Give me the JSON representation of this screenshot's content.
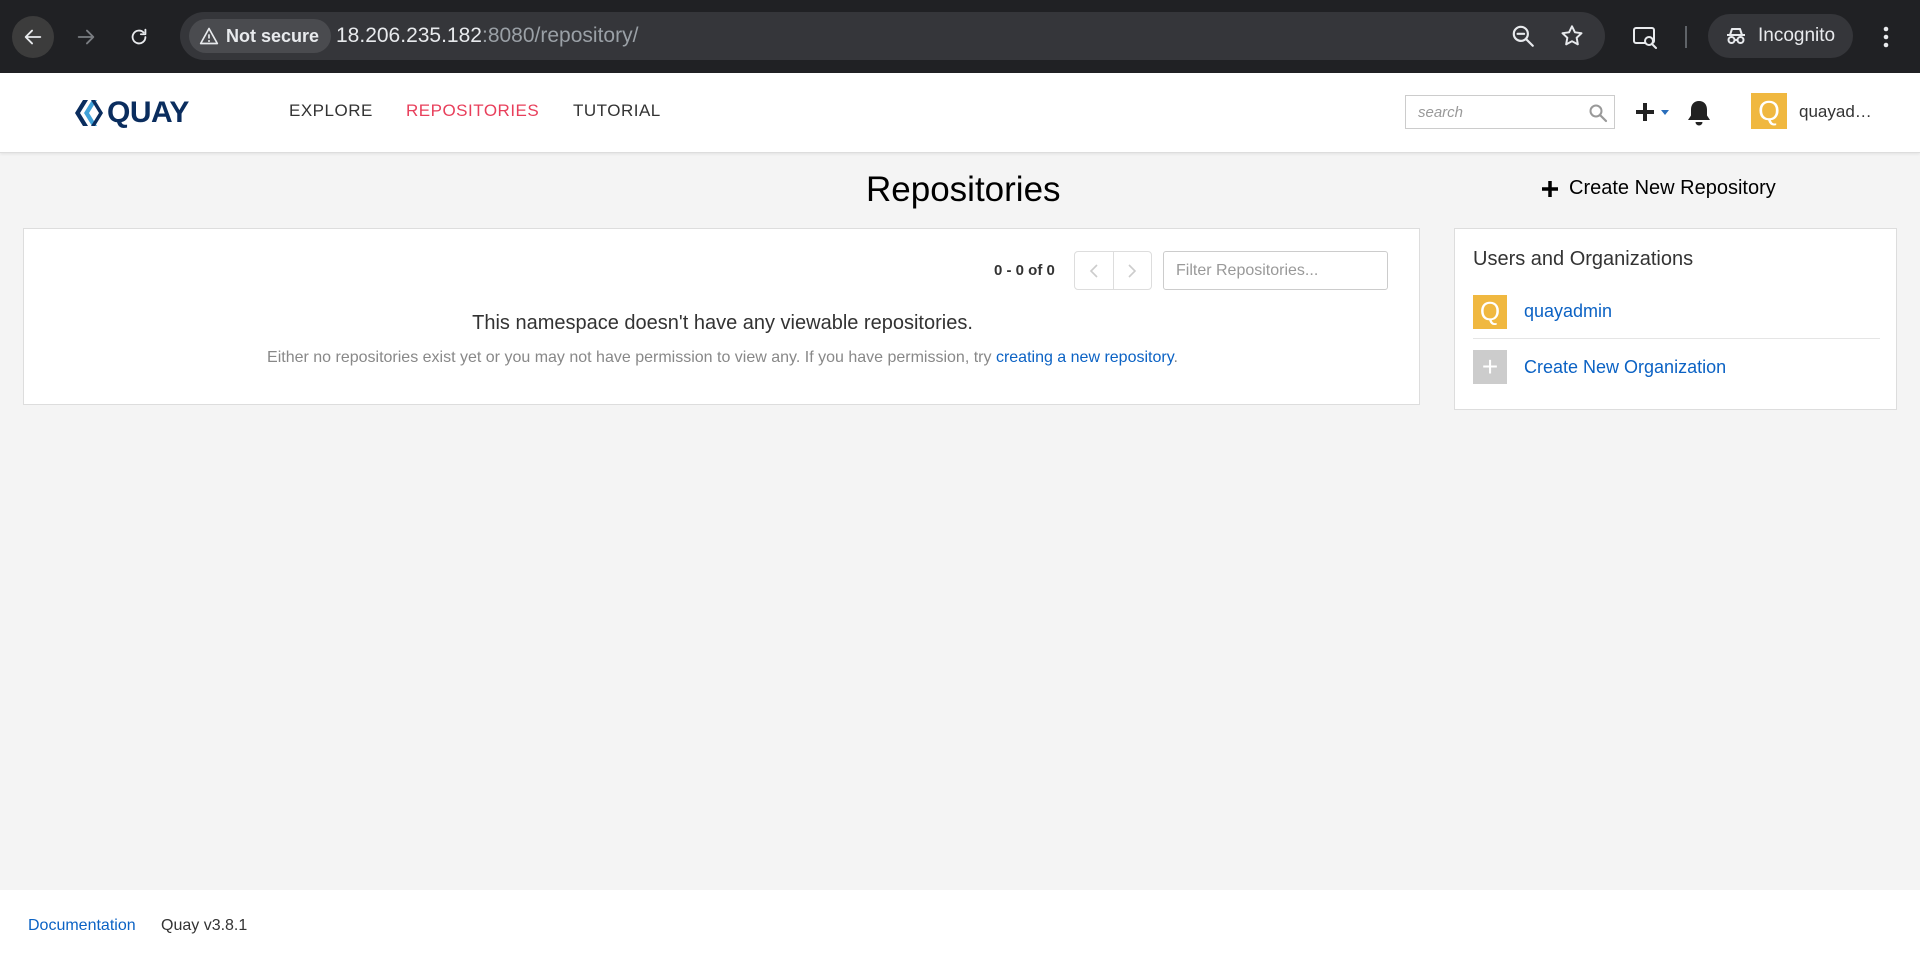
{
  "browser": {
    "security_label": "Not secure",
    "url_host": "18.206.235.182",
    "url_rest": ":8080/repository/",
    "profile_label": "Incognito"
  },
  "header": {
    "logo_text": "QUAY",
    "nav": {
      "explore": "EXPLORE",
      "repositories": "REPOSITORIES",
      "tutorial": "TUTORIAL"
    },
    "search_placeholder": "search",
    "user_initial": "Q",
    "user_name": "quayad…"
  },
  "main": {
    "title": "Repositories",
    "pager_text": "0 - 0 of 0",
    "filter_placeholder": "Filter Repositories...",
    "empty_title": "This namespace doesn't have any viewable repositories.",
    "empty_desc_prefix": "Either no repositories exist yet or you may not have permission to view any. If you have permission, try ",
    "empty_desc_link": "creating a new repository",
    "empty_desc_suffix": "."
  },
  "sidebar": {
    "create_repo_label": "Create New Repository",
    "panel_title": "Users and Organizations",
    "user_initial": "Q",
    "user_name": "quayadmin",
    "org_symbol": "+",
    "create_org_label": "Create New Organization"
  },
  "footer": {
    "documentation": "Documentation",
    "version": "Quay v3.8.1"
  },
  "colors": {
    "accent_active_nav": "#e83f5b",
    "link": "#0b62c4",
    "avatar": "#f0b840",
    "logo": "#0a2d5e"
  },
  "icons": [
    "back-arrow-icon",
    "forward-arrow-icon",
    "reload-icon",
    "warning-triangle-icon",
    "zoom-out-icon",
    "bookmark-star-icon",
    "cast-icon",
    "incognito-icon",
    "kebab-menu-icon",
    "quay-logo-icon",
    "search-icon",
    "plus-icon",
    "caret-down-icon",
    "bell-icon",
    "chevron-left-icon",
    "chevron-right-icon"
  ]
}
